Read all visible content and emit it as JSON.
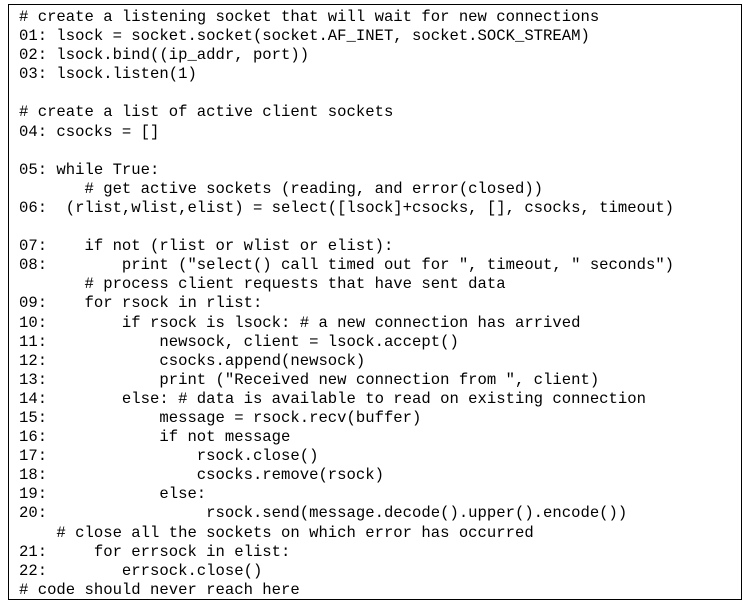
{
  "code": {
    "lines": [
      "# create a listening socket that will wait for new connections",
      "01: lsock = socket.socket(socket.AF_INET, socket.SOCK_STREAM)",
      "02: lsock.bind((ip_addr, port))",
      "03: lsock.listen(1)",
      "",
      "# create a list of active client sockets",
      "04: csocks = []",
      "",
      "05: while True:",
      "       # get active sockets (reading, and error(closed))",
      "06:  (rlist,wlist,elist) = select([lsock]+csocks, [], csocks, timeout)",
      "",
      "07:    if not (rlist or wlist or elist):",
      "08:        print (\"select() call timed out for \", timeout, \" seconds\")",
      "       # process client requests that have sent data",
      "09:    for rsock in rlist:",
      "10:        if rsock is lsock: # a new connection has arrived",
      "11:            newsock, client = lsock.accept()",
      "12:            csocks.append(newsock)",
      "13:            print (\"Received new connection from \", client)",
      "14:        else: # data is available to read on existing connection",
      "15:            message = rsock.recv(buffer)",
      "16:            if not message",
      "17:                rsock.close()",
      "18:                csocks.remove(rsock)",
      "19:            else:",
      "20:                 rsock.send(message.decode().upper().encode())",
      "    # close all the sockets on which error has occurred",
      "21:     for errsock in elist:",
      "22:        errsock.close()",
      "# code should never reach here"
    ]
  }
}
